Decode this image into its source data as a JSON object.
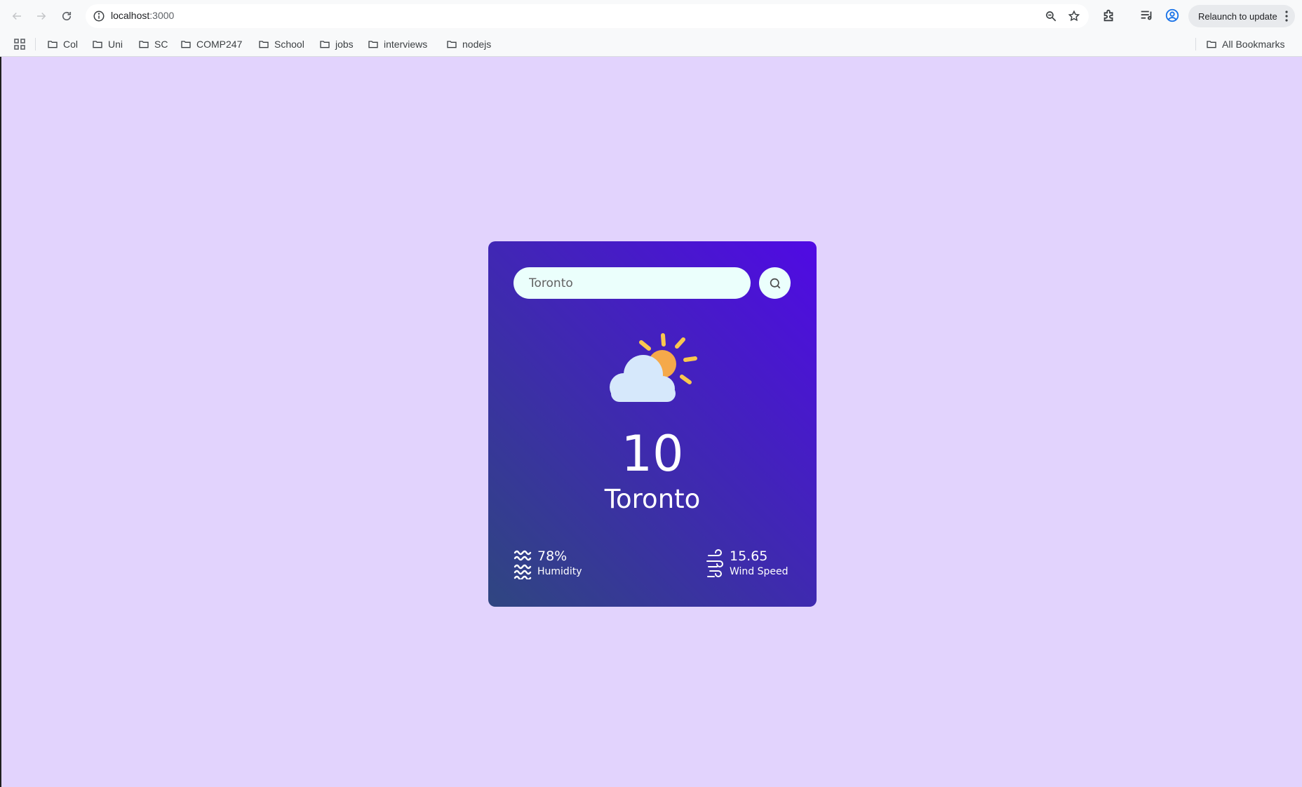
{
  "browser": {
    "url_host": "localhost",
    "url_port": ":3000",
    "relaunch_label": "Relaunch to update",
    "bookmarks": [
      "Col",
      "Uni",
      "SC",
      "COMP247",
      "School",
      "jobs",
      "interviews",
      "nodejs"
    ],
    "all_bookmarks_label": "All Bookmarks"
  },
  "weather": {
    "search_value": "Toronto",
    "icon": "partly-cloudy-icon",
    "temperature": "10",
    "city": "Toronto",
    "humidity_value": "78%",
    "humidity_label": "Humidity",
    "wind_value": "15.65",
    "wind_label": "Wind Speed"
  },
  "colors": {
    "page_background": "#e2d3fd",
    "card_gradient_start": "#2f4680",
    "card_gradient_end": "#500ae4",
    "search_background": "#ebfffc"
  }
}
